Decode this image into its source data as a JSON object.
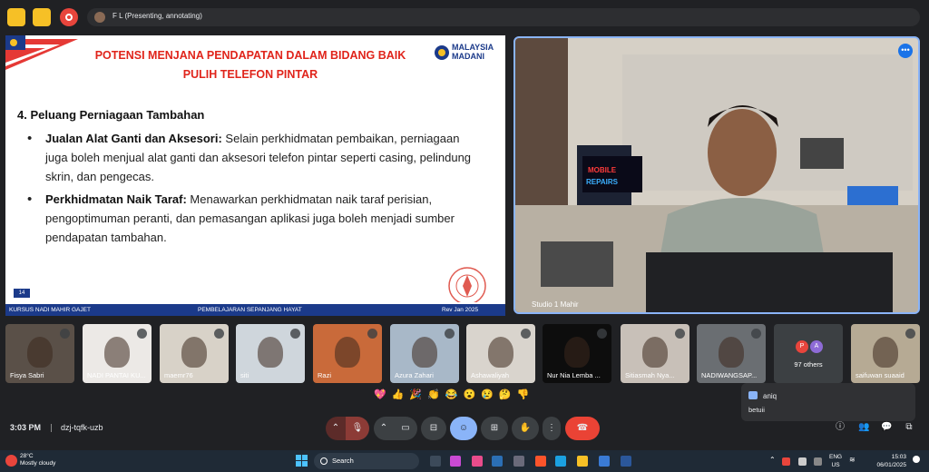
{
  "presenter": {
    "label": "F L (Presenting, annotating)"
  },
  "slide": {
    "title_line1": "POTENSI MENJANA PENDAPATAN DALAM BIDANG BAIK",
    "title_line2": "PULIH TELEFON PINTAR",
    "logo_text_1": "MALAYSIA",
    "logo_text_2": "MADANI",
    "heading": "4. Peluang Perniagaan Tambahan",
    "items": [
      {
        "bold": "Jualan Alat Ganti dan Aksesori:",
        "text": " Selain perkhidmatan pembaikan, perniagaan juga boleh menjual alat ganti dan aksesori telefon pintar seperti casing, pelindung skrin, dan pengecas."
      },
      {
        "bold": "Perkhidmatan Naik Taraf:",
        "text": " Menawarkan perkhidmatan naik taraf perisian, pengoptimuman peranti, dan pemasangan aplikasi juga boleh menjadi sumber pendapatan tambahan."
      }
    ],
    "page_number": "14",
    "footer_left": "KURSUS NADI MAHIR  GAJET",
    "footer_center": "PEMBELAJARAN SEPANJANG HAYAT",
    "footer_right": "Rev Jan 2025"
  },
  "main_video": {
    "name": "Studio 1 Mahir",
    "sign_text": "MOBILE REPAIRS"
  },
  "participants": [
    {
      "name": "Fisya Sabri",
      "bg": "#5a5048"
    },
    {
      "name": "NADI PANTAI KU...",
      "bg": "#ece9e6"
    },
    {
      "name": "maemr76",
      "bg": "#d8d2c8"
    },
    {
      "name": "siti",
      "bg": "#cfd6dc"
    },
    {
      "name": "Razi",
      "bg": "#c96a3a"
    },
    {
      "name": "Azura Zahari",
      "bg": "#a8b8c8"
    },
    {
      "name": "Ashawaliyah",
      "bg": "#d9d4cd"
    },
    {
      "name": "Nur Nia Lemba ...",
      "bg": "#0d0d0d"
    },
    {
      "name": "Sitiasmah Nya...",
      "bg": "#c8c0b8"
    },
    {
      "name": "NADIWANGSAP...",
      "bg": "#6a6e72"
    },
    {
      "name": "saifuwan suaaid",
      "bg": "#b6aa94"
    }
  ],
  "others": {
    "label": "97 others",
    "initials": [
      "P",
      "A"
    ]
  },
  "reactions": [
    "💖",
    "👍",
    "🎉",
    "👏",
    "😂",
    "😮",
    "😢",
    "🤔",
    "👎"
  ],
  "chat": {
    "sender": "aniq",
    "message": "betuii"
  },
  "meeting": {
    "time": "3:03 PM",
    "code": "dzj-tqfk-uzb"
  },
  "taskbar": {
    "temperature": "28°C",
    "weather": "Mostly cloudy",
    "search": "Search",
    "lang_1": "ENG",
    "lang_2": "US",
    "clock_time": "15:03",
    "clock_date": "06/01/2025"
  },
  "colors": {
    "accent": "#8ab4f8",
    "hangup": "#ea4335",
    "slide_title": "#e0241b",
    "slide_footer": "#1b3a8a"
  }
}
